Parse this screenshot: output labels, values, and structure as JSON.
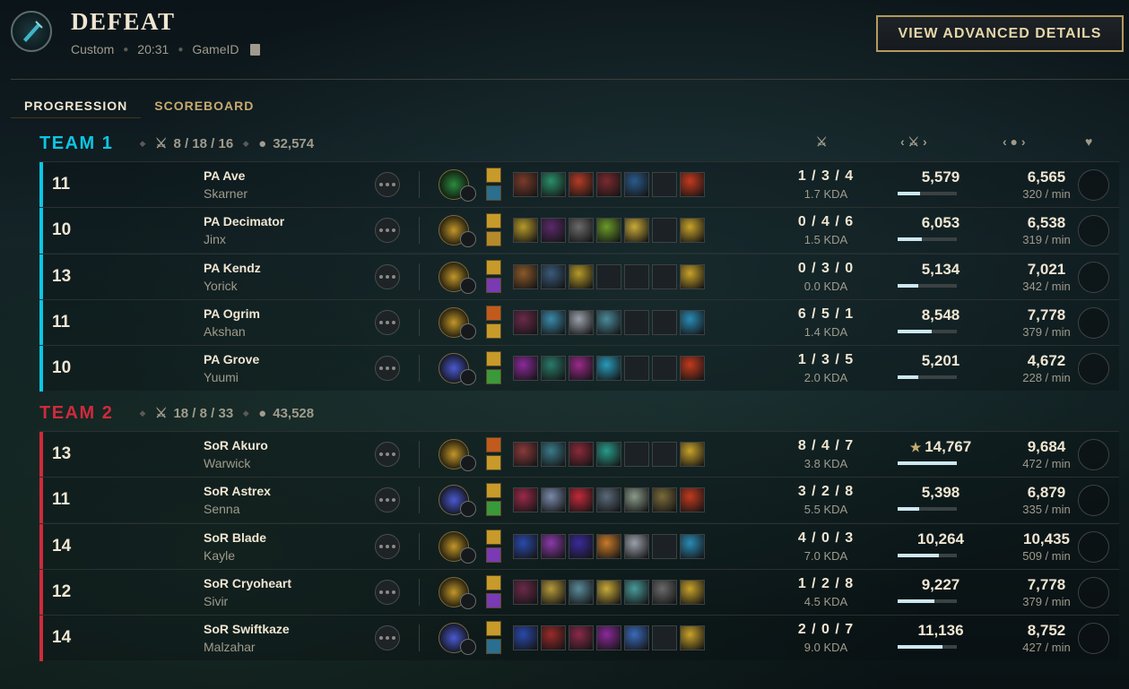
{
  "header": {
    "result": "DEFEAT",
    "mode": "Custom",
    "duration": "20:31",
    "game_id_label": "GameID",
    "advanced_button": "VIEW ADVANCED DETAILS"
  },
  "tabs": [
    {
      "label": "PROGRESSION",
      "active": true
    },
    {
      "label": "SCOREBOARD",
      "active": false
    }
  ],
  "colors": {
    "team1": "#0bc6e3",
    "team2": "#cf2a3c",
    "accent": "#c8aa6e"
  },
  "teams": [
    {
      "name": "TEAM 1",
      "kda": "8 / 18 / 16",
      "gold": "32,574",
      "players": [
        {
          "level": "11",
          "name": "PA Ave",
          "champion": "Skarner",
          "kda": "1 / 3 / 4",
          "ratio": "1.7 KDA",
          "damage": "5,579",
          "damage_fraction": 0.38,
          "gold": "6,565",
          "gpm": "320 / min",
          "rune": "#2b8a3e",
          "items": [
            "#7a3b2a",
            "#2a8f6a",
            "#b43c26",
            "#7a2a30",
            "#2a5a8a",
            "",
            "#c23a1e"
          ],
          "spells": [
            "#c79a2a",
            "#2a6f8f"
          ]
        },
        {
          "level": "10",
          "name": "PA Decimator",
          "champion": "Jinx",
          "kda": "0 / 4 / 6",
          "ratio": "1.5 KDA",
          "damage": "6,053",
          "damage_fraction": 0.41,
          "gold": "6,538",
          "gpm": "319 / min",
          "rune": "#c2962a",
          "items": [
            "#b59a2a",
            "#5a2a6a",
            "#6a6a6a",
            "#6a9a2a",
            "#c8aa3a",
            "",
            "#c8a22a"
          ],
          "spells": [
            "#c79a2a",
            "#b58a2a"
          ]
        },
        {
          "level": "13",
          "name": "PA Kendz",
          "champion": "Yorick",
          "kda": "0 / 3 / 0",
          "ratio": "0.0 KDA",
          "damage": "5,134",
          "damage_fraction": 0.35,
          "gold": "7,021",
          "gpm": "342 / min",
          "rune": "#c2962a",
          "items": [
            "#8a5a2a",
            "#3a5a7a",
            "#b59a2a",
            "",
            "",
            "",
            "#c8a22a"
          ],
          "spells": [
            "#c79a2a",
            "#7a3ab5"
          ]
        },
        {
          "level": "11",
          "name": "PA Ogrim",
          "champion": "Akshan",
          "kda": "6 / 5 / 1",
          "ratio": "1.4 KDA",
          "damage": "8,548",
          "damage_fraction": 0.58,
          "gold": "7,778",
          "gpm": "379 / min",
          "rune": "#c2962a",
          "items": [
            "#6a2a4a",
            "#3a8aaa",
            "#9aa0aa",
            "#4a8a9a",
            "",
            "",
            "#2a8ab5"
          ],
          "spells": [
            "#c25a1e",
            "#c79a2a"
          ]
        },
        {
          "level": "10",
          "name": "PA Grove",
          "champion": "Yuumi",
          "kda": "1 / 3 / 5",
          "ratio": "2.0 KDA",
          "damage": "5,201",
          "damage_fraction": 0.35,
          "gold": "4,672",
          "gpm": "228 / min",
          "rune": "#4a5ad0",
          "items": [
            "#8a2a9a",
            "#2a7a6a",
            "#9a2a8a",
            "#2a9aba",
            "",
            "",
            "#c23a1e"
          ],
          "spells": [
            "#c79a2a",
            "#3a9a3a"
          ]
        }
      ]
    },
    {
      "name": "TEAM 2",
      "kda": "18 / 8 / 33",
      "gold": "43,528",
      "players": [
        {
          "level": "13",
          "name": "SoR Akuro",
          "champion": "Warwick",
          "kda": "8 / 4 / 7",
          "ratio": "3.8 KDA",
          "damage": "14,767",
          "damage_fraction": 1.0,
          "top_damage": true,
          "gold": "9,684",
          "gpm": "472 / min",
          "rune": "#c2962a",
          "items": [
            "#8a3a3a",
            "#3a7a8a",
            "#8a2a3a",
            "#2a9a8a",
            "",
            "",
            "#c8a22a"
          ],
          "spells": [
            "#c25a1e",
            "#c79a2a"
          ]
        },
        {
          "level": "11",
          "name": "SoR Astrex",
          "champion": "Senna",
          "kda": "3 / 2 / 8",
          "ratio": "5.5 KDA",
          "damage": "5,398",
          "damage_fraction": 0.37,
          "gold": "6,879",
          "gpm": "335 / min",
          "rune": "#4a5ad0",
          "items": [
            "#9a2a4a",
            "#7a8aaa",
            "#c22a3a",
            "#5a6a7a",
            "#8a9a8a",
            "#7a6a3a",
            "#c23a1e"
          ],
          "spells": [
            "#c79a2a",
            "#3a9a3a"
          ]
        },
        {
          "level": "14",
          "name": "SoR Blade",
          "champion": "Kayle",
          "kda": "4 / 0 / 3",
          "ratio": "7.0 KDA",
          "damage": "10,264",
          "damage_fraction": 0.7,
          "gold": "10,435",
          "gpm": "509 / min",
          "rune": "#c2962a",
          "items": [
            "#2a4aaa",
            "#8a3aaa",
            "#3a2a9a",
            "#c87a2a",
            "#9aa0aa",
            "",
            "#2a8ab5"
          ],
          "spells": [
            "#c79a2a",
            "#7a3ab5"
          ]
        },
        {
          "level": "12",
          "name": "SoR Cryoheart",
          "champion": "Sivir",
          "kda": "1 / 2 / 8",
          "ratio": "4.5 KDA",
          "damage": "9,227",
          "damage_fraction": 0.62,
          "gold": "7,778",
          "gpm": "379 / min",
          "rune": "#c2962a",
          "items": [
            "#6a2a4a",
            "#b59a3a",
            "#5a8a9a",
            "#c8aa3a",
            "#4a9a9a",
            "#6a6a6a",
            "#c8a22a"
          ],
          "spells": [
            "#c79a2a",
            "#7a3ab5"
          ]
        },
        {
          "level": "14",
          "name": "SoR Swiftkaze",
          "champion": "Malzahar",
          "kda": "2 / 0 / 7",
          "ratio": "9.0 KDA",
          "damage": "11,136",
          "damage_fraction": 0.75,
          "gold": "8,752",
          "gpm": "427 / min",
          "rune": "#4a5ad0",
          "items": [
            "#2a4aaa",
            "#9a2a2a",
            "#8a2a4a",
            "#8a2a9a",
            "#3a6aba",
            "",
            "#c8a22a"
          ],
          "spells": [
            "#c79a2a",
            "#2a6f8f"
          ]
        }
      ]
    }
  ]
}
